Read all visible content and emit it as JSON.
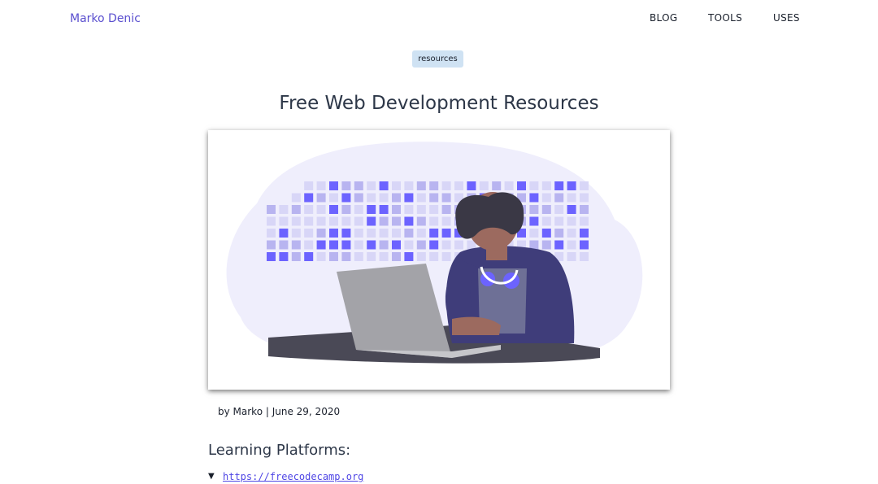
{
  "header": {
    "site_title": "Marko Denic",
    "nav": [
      {
        "label": "BLOG"
      },
      {
        "label": "TOOLS"
      },
      {
        "label": "USES"
      }
    ]
  },
  "post": {
    "tag": "resources",
    "title": "Free Web Development Resources",
    "byline": "by Marko | June 29, 2020",
    "section_heading": "Learning Platforms:",
    "links": [
      {
        "marker": "▼",
        "url": "https://freecodecamp.org"
      }
    ]
  },
  "colors": {
    "accent": "#5a4fcf",
    "tile_dark": "#6c63ff",
    "tile_light": "#d8d6f7",
    "blob": "#efeefc"
  }
}
